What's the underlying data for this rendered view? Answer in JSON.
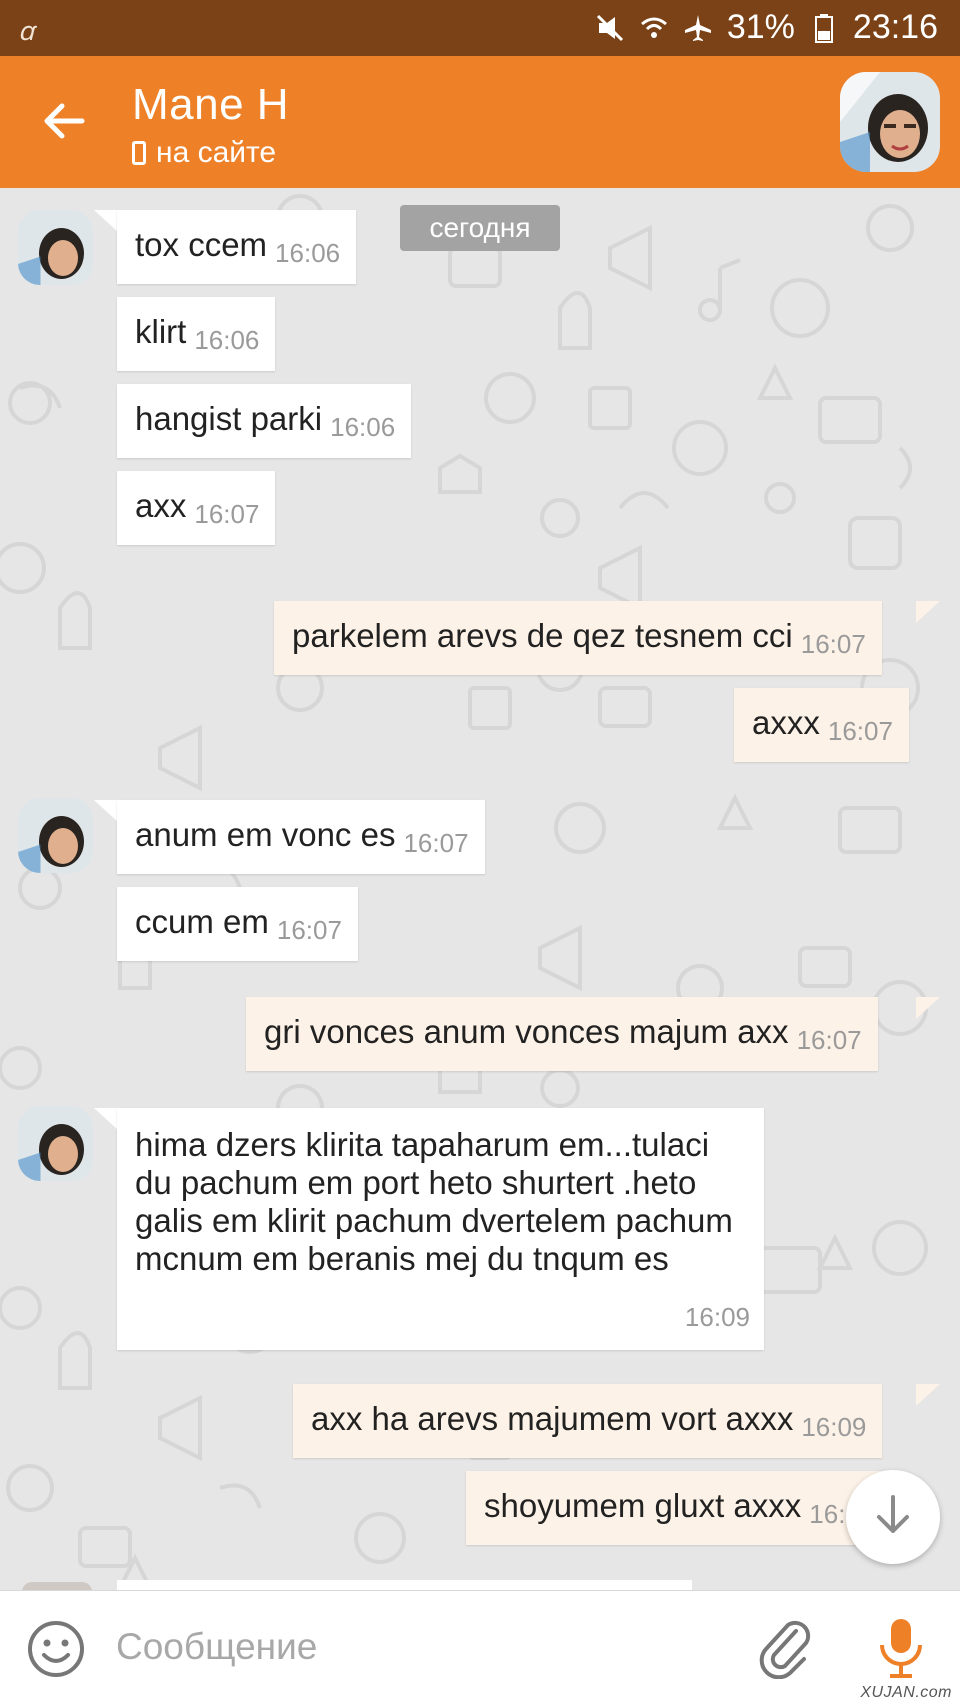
{
  "status_bar": {
    "left_glyph": "ꭤ",
    "battery": "31%",
    "time": "23:16",
    "icons": [
      "mute-vibrate-icon",
      "wifi-icon",
      "airplane-icon",
      "battery-icon"
    ]
  },
  "header": {
    "contact_name": "Mane H",
    "presence": "на сайте",
    "accent_color": "#ee8128"
  },
  "chat": {
    "date_divider": "сегодня",
    "messages": [
      {
        "dir": "in",
        "text": "tox ccem",
        "time": "16:06"
      },
      {
        "dir": "in",
        "text": "klirt",
        "time": "16:06"
      },
      {
        "dir": "in",
        "text": "hangist parki",
        "time": "16:06"
      },
      {
        "dir": "in",
        "text": "axx",
        "time": "16:07"
      },
      {
        "dir": "out",
        "text": "parkelem arevs de qez tesnem cci",
        "time": "16:07"
      },
      {
        "dir": "out",
        "text": "axxx",
        "time": "16:07"
      },
      {
        "dir": "in",
        "text": "anum em vonc es",
        "time": "16:07"
      },
      {
        "dir": "in",
        "text": "ccum em",
        "time": "16:07"
      },
      {
        "dir": "out",
        "text": "gri vonces anum vonces majum axx",
        "time": "16:07"
      },
      {
        "dir": "in",
        "text": "hima dzers klirita tapaharum em...tulaci du pachum em port heto shurtert .heto galis em klirit pachum dvertelem pachum mcnum em beranis mej du tnqum es",
        "time": "16:09"
      },
      {
        "dir": "out",
        "text": "axx ha arevs majumem vort axxx",
        "time": "16:09"
      },
      {
        "dir": "out",
        "text": "shoyumem gluxt axxx",
        "time": "16:09"
      }
    ]
  },
  "composer": {
    "placeholder": "Сообщение"
  },
  "watermark": "XUJAN.com"
}
